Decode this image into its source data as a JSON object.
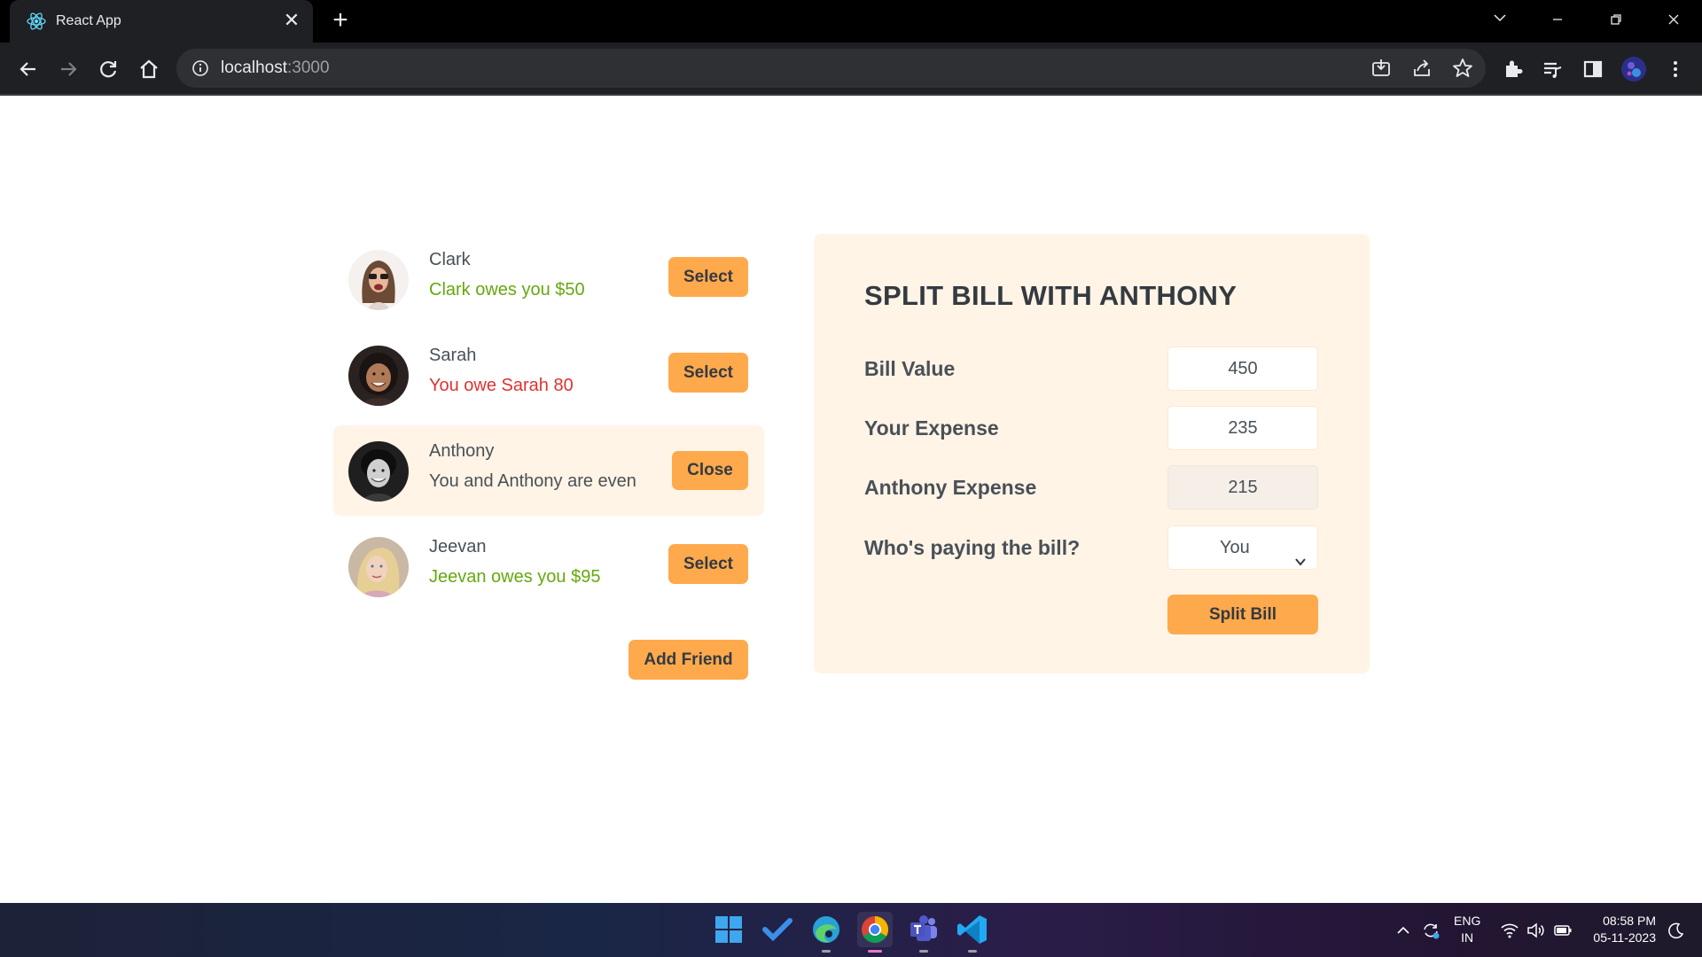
{
  "browser": {
    "tab_title": "React App",
    "url_host": "localhost",
    "url_port": ":3000"
  },
  "friends": [
    {
      "name": "Clark",
      "status": "Clark owes you $50",
      "status_color": "#66a80f",
      "button": "Select"
    },
    {
      "name": "Sarah",
      "status": "You owe Sarah 80",
      "status_color": "#e03131",
      "button": "Select"
    },
    {
      "name": "Anthony",
      "status": "You and Anthony are even",
      "status_color": "#495057",
      "button": "Close"
    },
    {
      "name": "Jeevan",
      "status": "Jeevan owes you $95",
      "status_color": "#66a80f",
      "button": "Select"
    }
  ],
  "add_friend_label": "Add Friend",
  "split_form": {
    "title": "SPLIT BILL WITH ANTHONY",
    "bill_value_label": "Bill Value",
    "bill_value": "450",
    "your_expense_label": "Your Expense",
    "your_expense": "235",
    "friend_expense_label": "Anthony Expense",
    "friend_expense": "215",
    "payer_label": "Who's paying the bill?",
    "payer_selected": "You",
    "submit_label": "Split Bill"
  },
  "colors": {
    "accent": "#ffa94d",
    "panel_bg": "#fff4e6"
  },
  "taskbar": {
    "language": "ENG",
    "region": "IN",
    "time": "08:58 PM",
    "date": "05-11-2023"
  }
}
